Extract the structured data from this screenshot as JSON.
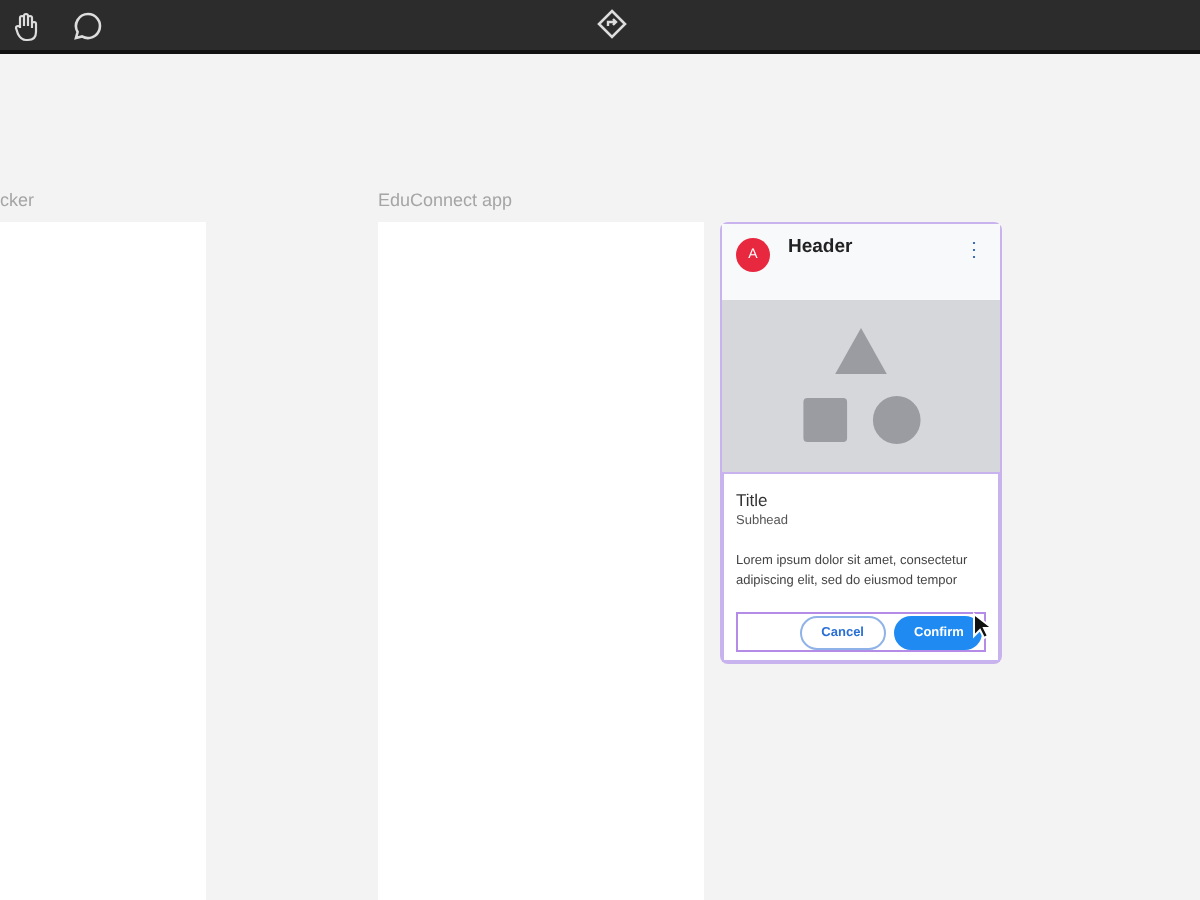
{
  "canvas": {
    "frames": [
      {
        "label": "cker"
      },
      {
        "label": "EduConnect app"
      }
    ],
    "card": {
      "avatar": "A",
      "header": "Header",
      "menu": "⋮",
      "title": "Title",
      "subhead": "Subhead",
      "body": "Lorem ipsum dolor sit amet, consectetur adipiscing elit, sed do eiusmod tempor",
      "buttons": [
        {
          "label": "Cancel",
          "kind": "outlined"
        },
        {
          "label": "Confirm",
          "kind": "filled"
        }
      ]
    }
  }
}
